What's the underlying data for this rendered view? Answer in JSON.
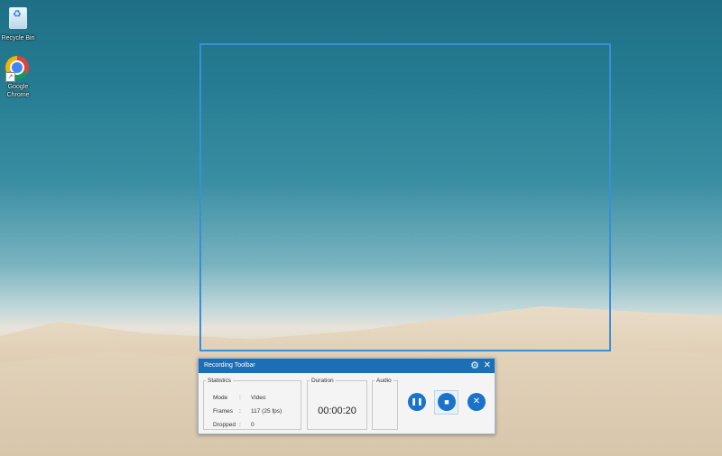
{
  "desktop": {
    "icons": [
      {
        "label": "Recycle Bin",
        "icon": "recycle-bin-icon"
      },
      {
        "label": "Google Chrome",
        "icon": "chrome-icon"
      }
    ]
  },
  "toolbar": {
    "title": "Recording Toolbar",
    "statistics": {
      "legend": "Statistics",
      "rows": [
        {
          "label": "Mode",
          "sep": ":",
          "value": "Video"
        },
        {
          "label": "Frames",
          "sep": ":",
          "value": "117 (25 fps)"
        },
        {
          "label": "Dropped",
          "sep": ":",
          "value": "0"
        }
      ]
    },
    "duration": {
      "legend": "Duration",
      "value": "00:00:20"
    },
    "audio": {
      "legend": "Audio"
    },
    "controls": {
      "pause": "❚❚",
      "stop": "■",
      "cancel": "✕"
    },
    "icons": {
      "settings": "⚙",
      "close": "✕"
    }
  },
  "colors": {
    "accent": "#1c6fb7",
    "region_border": "#3b8ed8"
  }
}
